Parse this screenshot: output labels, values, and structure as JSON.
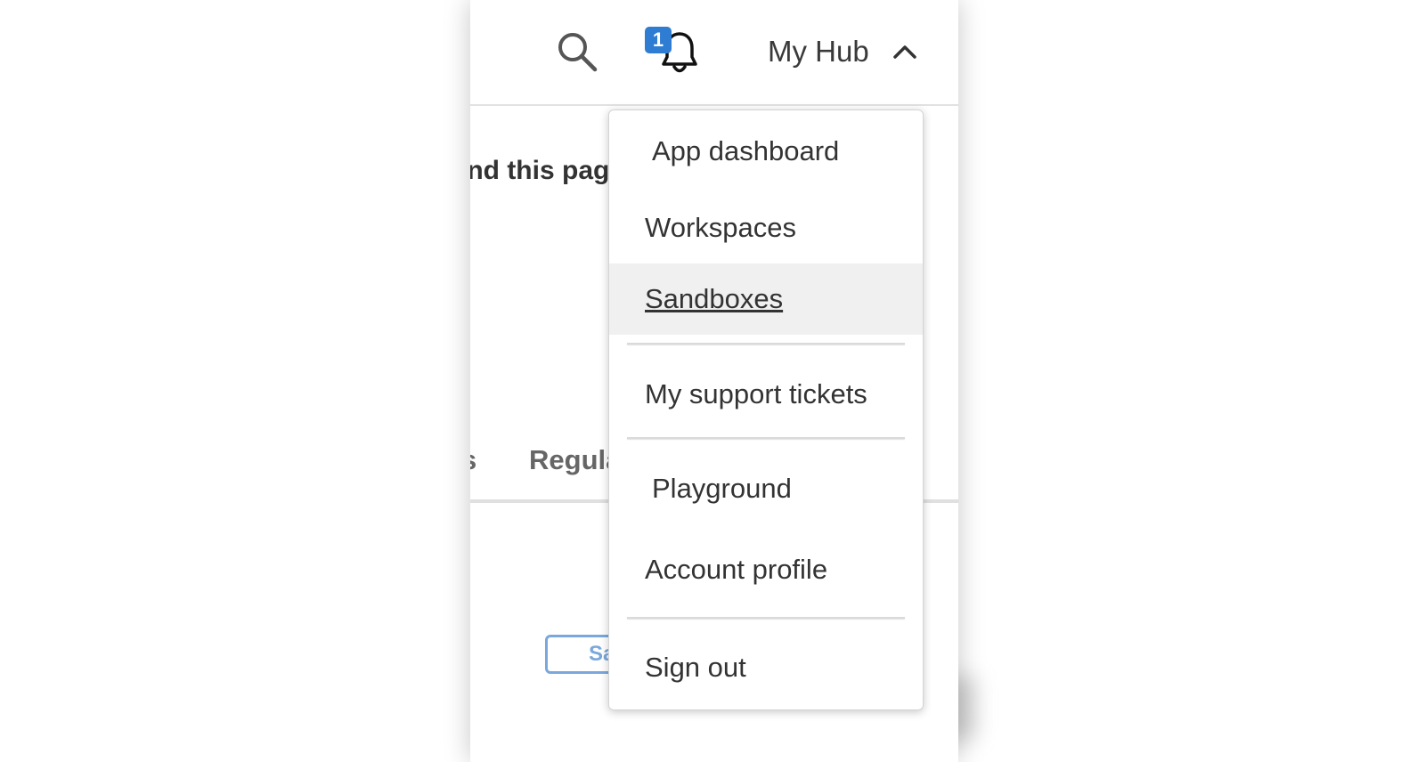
{
  "header": {
    "notification_count": "1",
    "hub_label": "My Hub"
  },
  "background": {
    "hint_text": "ind this pag",
    "tab_left_fragment": "s",
    "tab_regular_fragment": "Regula",
    "button_fragment": "Sa"
  },
  "menu": {
    "items": [
      {
        "label": "App dashboard"
      },
      {
        "label": "Workspaces"
      },
      {
        "label": "Sandboxes",
        "state": "hovered"
      },
      {
        "label": "My support tickets"
      },
      {
        "label": "Playground"
      },
      {
        "label": "Account profile"
      },
      {
        "label": "Sign out"
      }
    ]
  },
  "colors": {
    "badge": "#2f7cd3",
    "hover_bg": "#f0f0f0",
    "text": "#333333"
  },
  "icons": {
    "search": "search-icon",
    "bell": "bell-icon",
    "chevron": "chevron-up-icon"
  }
}
